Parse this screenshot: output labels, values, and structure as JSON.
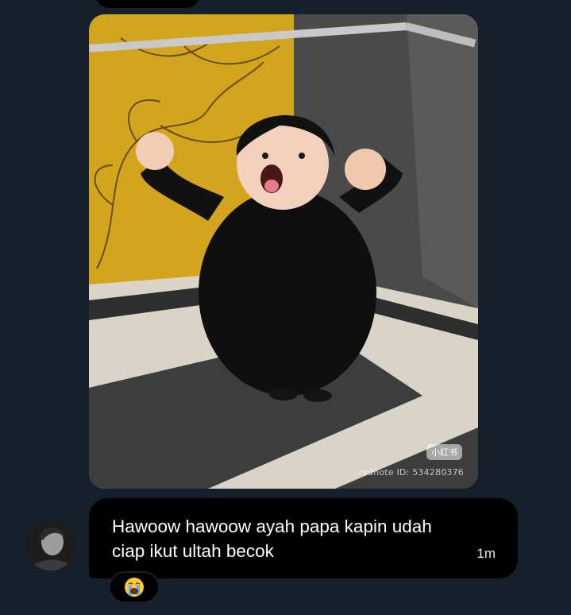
{
  "media": {
    "watermark_logo": "小红书",
    "watermark_id": "rednote ID: 534280376"
  },
  "message": {
    "text_line1": "Hawoow hawoow ayah papa kapin udah",
    "text_line2": "ciap ikut ultah becok",
    "timestamp": "1m"
  },
  "reaction": {
    "emoji": "😭",
    "icon": "loudly-crying-face-icon"
  },
  "colors": {
    "background": "#15202b",
    "bubble": "#000000",
    "text": "#ffffff"
  }
}
